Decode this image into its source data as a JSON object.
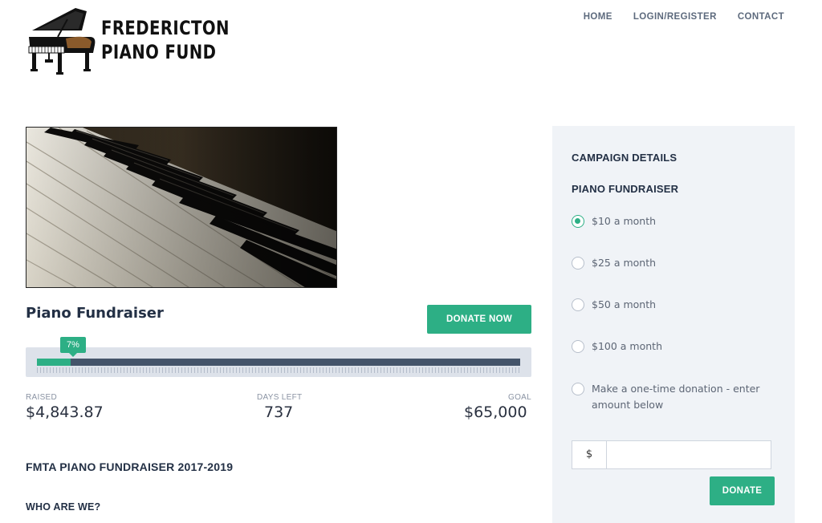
{
  "brand": {
    "line1": "FREDERICTON",
    "line2": "PIANO FUND"
  },
  "nav": {
    "home": "HOME",
    "login": "LOGIN/REGISTER",
    "contact": "CONTACT"
  },
  "campaign": {
    "title": "Piano Fundraiser",
    "donate_now_label": "DONATE NOW",
    "progress_percent": 7,
    "progress_label": "7%",
    "raised_label": "RAISED",
    "raised_value": "$4,843.87",
    "days_label": "DAYS LEFT",
    "days_value": "737",
    "goal_label": "GOAL",
    "goal_value": "$65,000"
  },
  "content": {
    "heading": "FMTA PIANO FUNDRAISER 2017-2019",
    "subheading": "WHO ARE WE?"
  },
  "sidebar": {
    "heading": "CAMPAIGN DETAILS",
    "subheading": "PIANO FUNDRAISER",
    "options": [
      {
        "label": "$10 a month",
        "checked": true
      },
      {
        "label": "$25 a month",
        "checked": false
      },
      {
        "label": "$50 a month",
        "checked": false
      },
      {
        "label": "$100 a month",
        "checked": false
      },
      {
        "label": "Make a one-time donation - enter amount below",
        "checked": false
      }
    ],
    "currency_symbol": "$",
    "amount_value": "",
    "donate_label": "DONATE"
  },
  "colors": {
    "accent": "#2daf85",
    "track": "#44546a",
    "sidebar_bg": "#f0f3f7",
    "heading": "#233045"
  }
}
